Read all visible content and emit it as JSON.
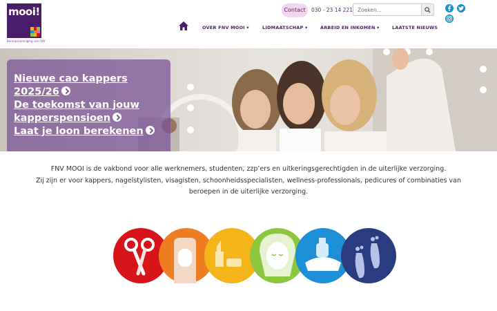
{
  "brand": {
    "logo_text": "mooi!",
    "logo_sub": "Beroepsvereniging van FNV"
  },
  "topbar": {
    "contact_label": "Contact",
    "phone": "030 - 23 14 221",
    "search_placeholder": "Zoeken..."
  },
  "nav": {
    "items": [
      {
        "label": "OVER FNV MOOI",
        "dropdown": true
      },
      {
        "label": "LIDMAATSCHAP",
        "dropdown": true
      },
      {
        "label": "ARBEID EN INKOMEN",
        "dropdown": true
      },
      {
        "label": "LAATSTE NIEUWS",
        "dropdown": false
      }
    ],
    "caret": "▾"
  },
  "hero": {
    "links": [
      "Nieuwe cao kappers",
      "2025/26",
      "De toekomst van jouw",
      "kapperspensioen",
      "Laat je loon berekenen"
    ]
  },
  "intro": {
    "lines": [
      "FNV MOOI is de vakbond voor alle werknemers, studenten, zzp’ers en uitkeringsgerechtigden in de uiterlijke verzorging.",
      "Zij zijn er voor kappers, nagelstylisten, visagisten, schoonheidsspecialisten, wellness-professionals, pedicures of combinaties van",
      "beroepen in de uiterlijke verzorging."
    ]
  },
  "professions": [
    {
      "name": "kappers",
      "icon": "scissors-icon",
      "color": "#d7141a"
    },
    {
      "name": "nagelstylisten",
      "icon": "nail-icon",
      "color": "#ef7d22"
    },
    {
      "name": "visagisten",
      "icon": "lipstick-icon",
      "color": "#f4b41a"
    },
    {
      "name": "schoonheidsspecialisten",
      "icon": "face-mask-icon",
      "color": "#8cc63f"
    },
    {
      "name": "wellness",
      "icon": "cream-jar-icon",
      "color": "#1c8fd6"
    },
    {
      "name": "pedicures",
      "icon": "feet-icon",
      "color": "#2a3b80"
    }
  ],
  "colors": {
    "brand_purple": "#4a1d6b",
    "social_blue": "#1a8fd6",
    "contact_pink": "#f0d7ec"
  }
}
